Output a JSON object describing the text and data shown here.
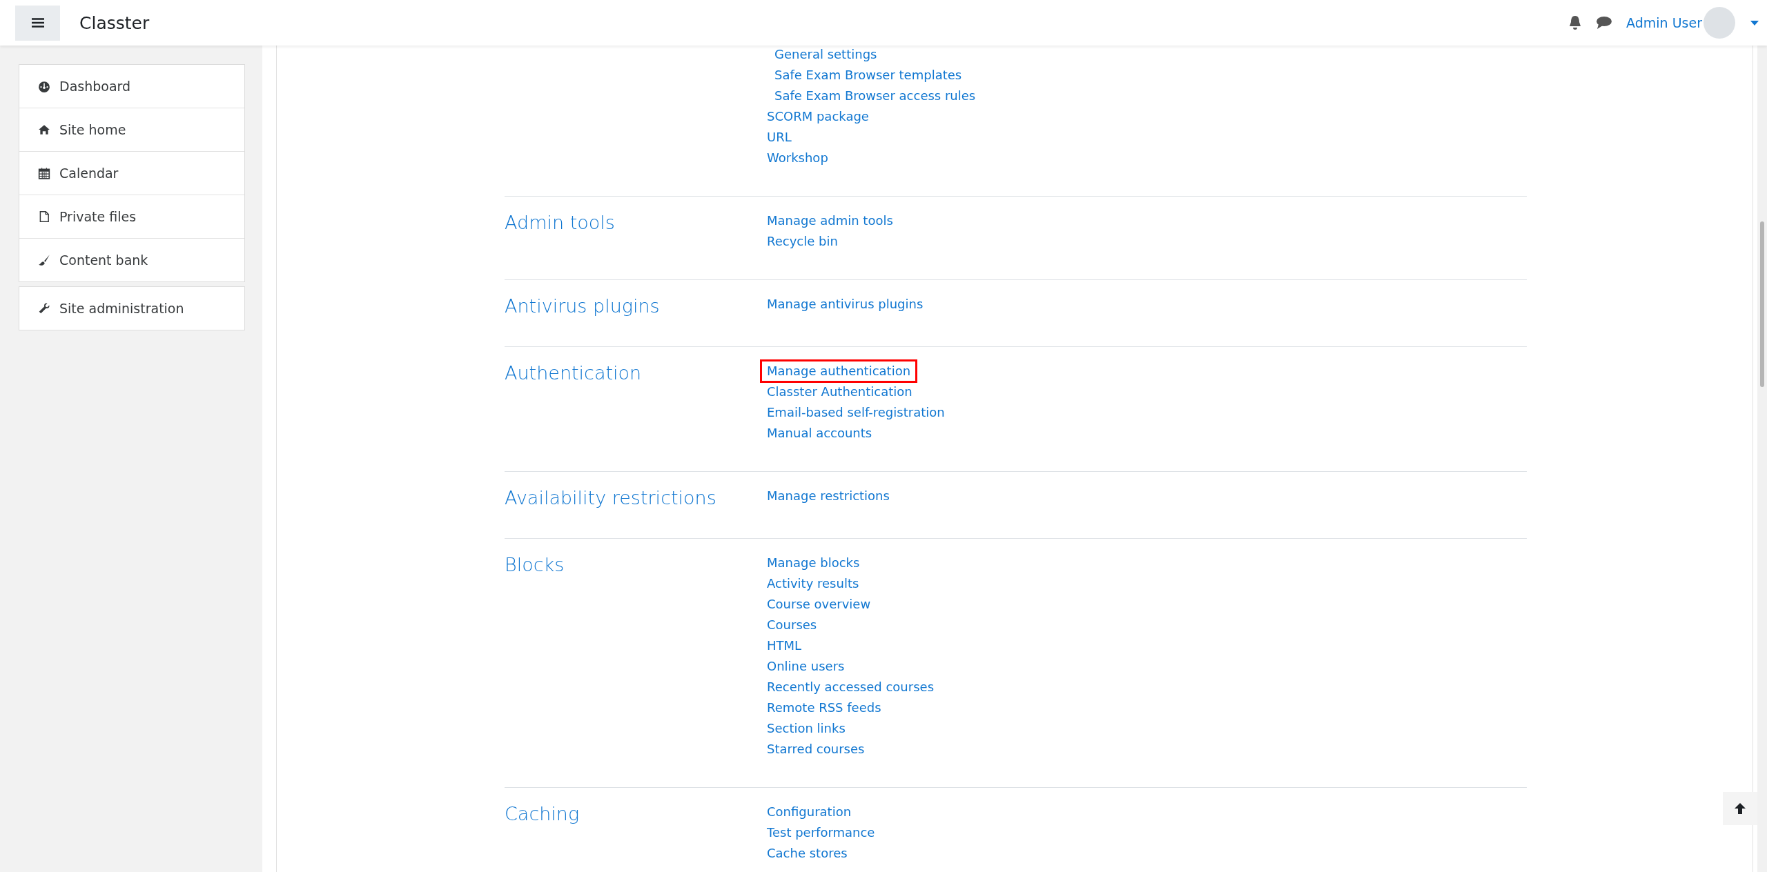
{
  "header": {
    "title": "Classter",
    "user_name": "Admin User"
  },
  "sidebar": {
    "items": [
      {
        "label": "Dashboard",
        "kind": "dashboard",
        "selected": false
      },
      {
        "label": "Site home",
        "kind": "home",
        "selected": false
      },
      {
        "label": "Calendar",
        "kind": "calendar",
        "selected": false
      },
      {
        "label": "Private files",
        "kind": "file",
        "selected": false
      },
      {
        "label": "Content bank",
        "kind": "brush",
        "selected": false
      }
    ],
    "admin_item": {
      "label": "Site administration",
      "kind": "wrench",
      "selected": false
    }
  },
  "sections": [
    {
      "nested_links": [
        {
          "label": "General settings",
          "highlighted": false
        },
        {
          "label": "Safe Exam Browser templates",
          "highlighted": false
        },
        {
          "label": "Safe Exam Browser access rules",
          "highlighted": false
        }
      ],
      "links": [
        {
          "label": "SCORM package",
          "highlighted": false
        },
        {
          "label": "URL",
          "highlighted": false
        },
        {
          "label": "Workshop",
          "highlighted": false
        }
      ]
    },
    {
      "heading": "Admin tools",
      "links": [
        {
          "label": "Manage admin tools",
          "highlighted": false
        },
        {
          "label": "Recycle bin",
          "highlighted": false
        }
      ]
    },
    {
      "heading": "Antivirus plugins",
      "links": [
        {
          "label": "Manage antivirus plugins",
          "highlighted": false
        }
      ]
    },
    {
      "heading": "Authentication",
      "links": [
        {
          "label": "Manage authentication",
          "highlighted": true
        },
        {
          "label": "Classter Authentication",
          "highlighted": false
        },
        {
          "label": "Email-based self-registration",
          "highlighted": false
        },
        {
          "label": "Manual accounts",
          "highlighted": false
        }
      ]
    },
    {
      "heading": "Availability restrictions",
      "links": [
        {
          "label": "Manage restrictions",
          "highlighted": false
        }
      ]
    },
    {
      "heading": "Blocks",
      "links": [
        {
          "label": "Manage blocks",
          "highlighted": false
        },
        {
          "label": "Activity results",
          "highlighted": false
        },
        {
          "label": "Course overview",
          "highlighted": false
        },
        {
          "label": "Courses",
          "highlighted": false
        },
        {
          "label": "HTML",
          "highlighted": false
        },
        {
          "label": "Online users",
          "highlighted": false
        },
        {
          "label": "Recently accessed courses",
          "highlighted": false
        },
        {
          "label": "Remote RSS feeds",
          "highlighted": false
        },
        {
          "label": "Section links",
          "highlighted": false
        },
        {
          "label": "Starred courses",
          "highlighted": false
        }
      ]
    },
    {
      "heading": "Caching",
      "links": [
        {
          "label": "Configuration",
          "highlighted": false
        },
        {
          "label": "Test performance",
          "highlighted": false
        },
        {
          "label": "Cache stores",
          "highlighted": false
        }
      ]
    }
  ]
}
